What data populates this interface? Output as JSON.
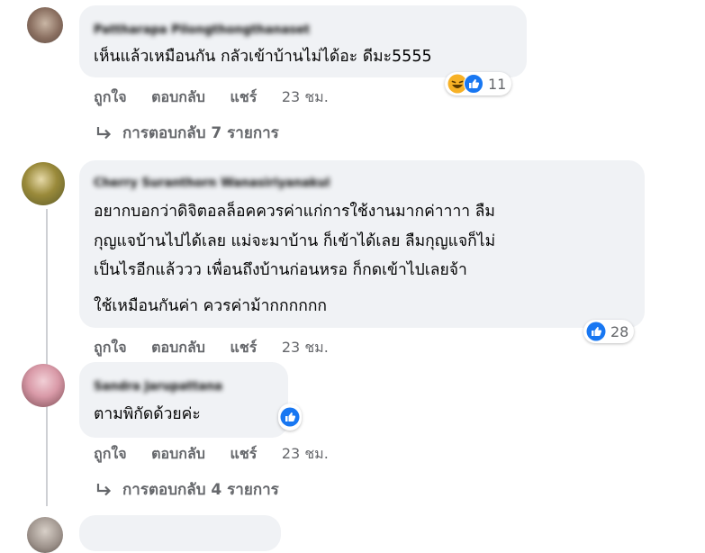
{
  "comments": [
    {
      "author": "Pattharapa Pilongthongthanaset",
      "text_lines": [
        "เห็นแล้วเหมือนกัน กลัวเข้าบ้านไม่ได้อะ ดีมะ5555"
      ],
      "actions": {
        "like": "ถูกใจ",
        "reply": "ตอบกลับ",
        "share": "แชร์",
        "time": "23 ชม."
      },
      "reactions": {
        "count": "11",
        "icons": [
          "haha-icon",
          "like-icon"
        ]
      },
      "replies_label": "การตอบกลับ 7 รายการ"
    },
    {
      "author": "Cherry Suranthorn Wanasiriyanakul",
      "text_lines": [
        "อยากบอกว่าดิจิตอลล็อคควรค่าแก่การใช้งานมากค่าาาา ลืม",
        "กุญแจบ้านไปได้เลย แม่จะมาบ้าน ก็เข้าได้เลย ลืมกุญแจก็ไม่",
        "เป็นไรอีกแล้ววว เพื่อนถึงบ้านก่อนหรอ ก็กดเข้าไปเลยจ้า"
      ],
      "text_extra": "ใช้เหมือนกันค่า ควรค่าม้ากกกกกก",
      "actions": {
        "like": "ถูกใจ",
        "reply": "ตอบกลับ",
        "share": "แชร์",
        "time": "23 ชม."
      },
      "reactions": {
        "count": "28",
        "icons": [
          "like-icon"
        ]
      }
    },
    {
      "author": "Sandra Jarupattana",
      "text_lines": [
        "ตามพิกัดด้วยค่ะ"
      ],
      "actions": {
        "like": "ถูกใจ",
        "reply": "ตอบกลับ",
        "share": "แชร์",
        "time": "23 ชม."
      },
      "reactions": {
        "count": "",
        "icons": [
          "like-icon"
        ]
      },
      "replies_label": "การตอบกลับ 4 รายการ"
    }
  ],
  "colors": {
    "bubble": "#f0f2f5",
    "like_blue": "#1877f2",
    "haha_yellow": "#f7b125",
    "secondary_text": "#65676b"
  }
}
